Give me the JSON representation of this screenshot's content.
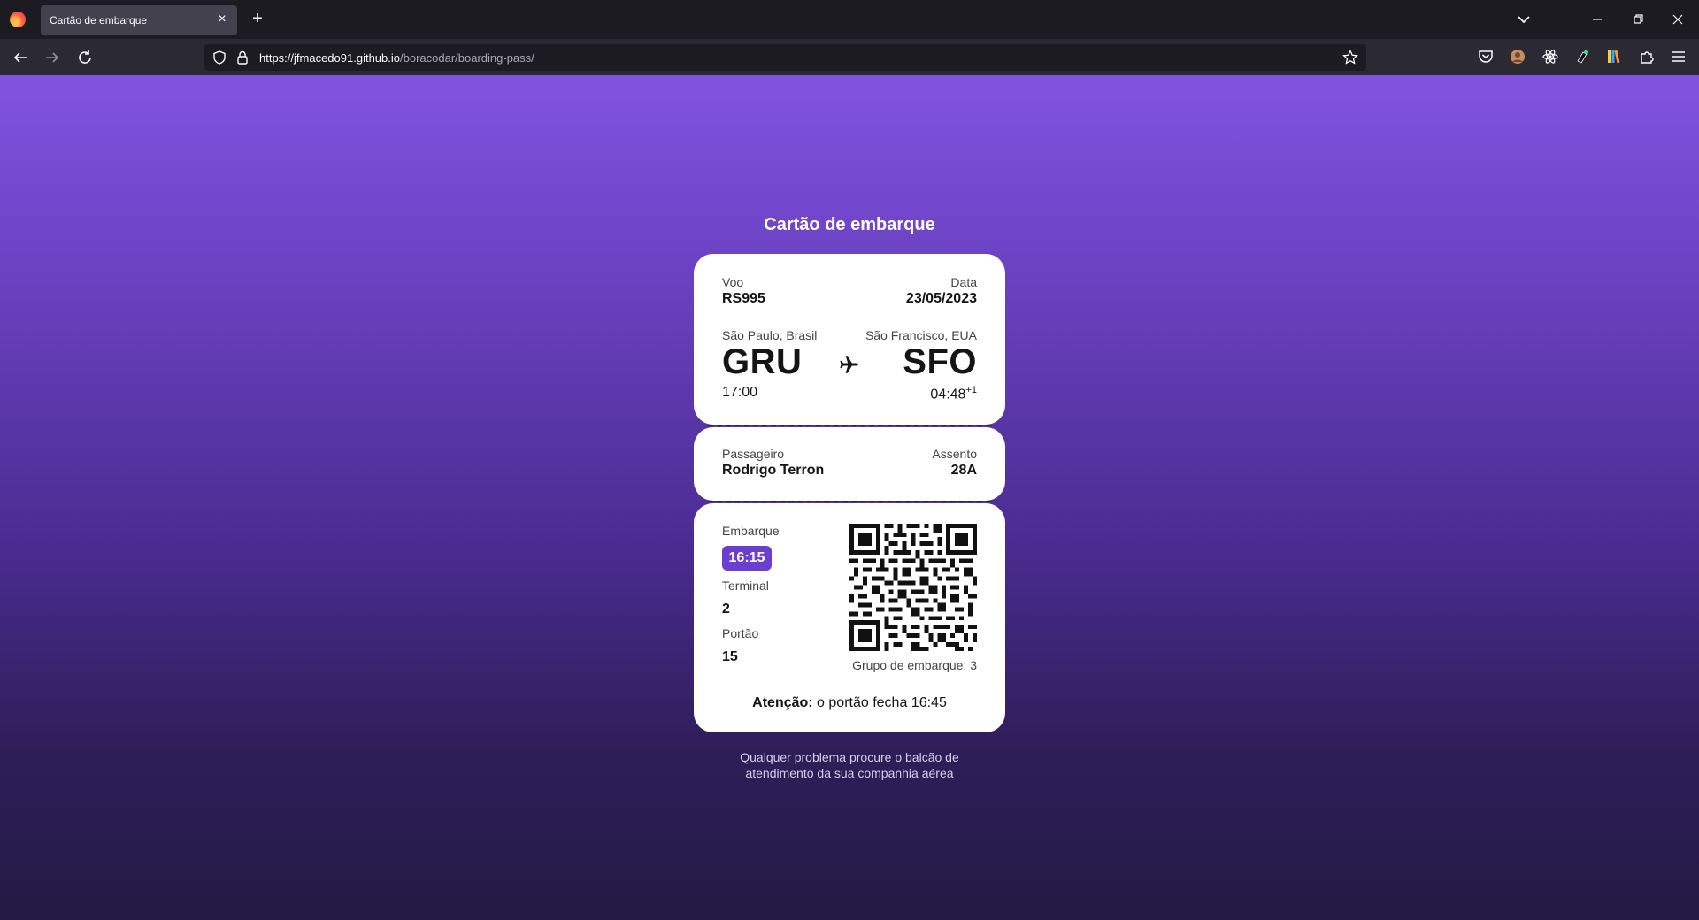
{
  "browser": {
    "tab_title": "Cartão de embarque",
    "url_host": "https://jfmacedo91.github.io",
    "url_path": "/boracodar/boarding-pass/"
  },
  "page": {
    "title": "Cartão de embarque",
    "flight": {
      "label": "Voo",
      "value": "RS995"
    },
    "date": {
      "label": "Data",
      "value": "23/05/2023"
    },
    "origin": {
      "city": "São Paulo, Brasil",
      "code": "GRU",
      "time": "17:00"
    },
    "destination": {
      "city": "São Francisco, EUA",
      "code": "SFO",
      "time": "04:48",
      "day_offset": "+1"
    },
    "passenger": {
      "label": "Passageiro",
      "value": "Rodrigo Terron"
    },
    "seat": {
      "label": "Assento",
      "value": "28A"
    },
    "boarding": {
      "label": "Embarque",
      "value": "16:15"
    },
    "terminal": {
      "label": "Terminal",
      "value": "2"
    },
    "gate": {
      "label": "Portão",
      "value": "15"
    },
    "boarding_group": "Grupo de embarque: 3",
    "attention": {
      "strong": "Atenção:",
      "text": " o portão fecha 16:45"
    },
    "footnote_line1": "Qualquer problema procure o balcão de",
    "footnote_line2": "atendimento da sua companhia aérea",
    "accent_color": "#6a3fd0"
  }
}
